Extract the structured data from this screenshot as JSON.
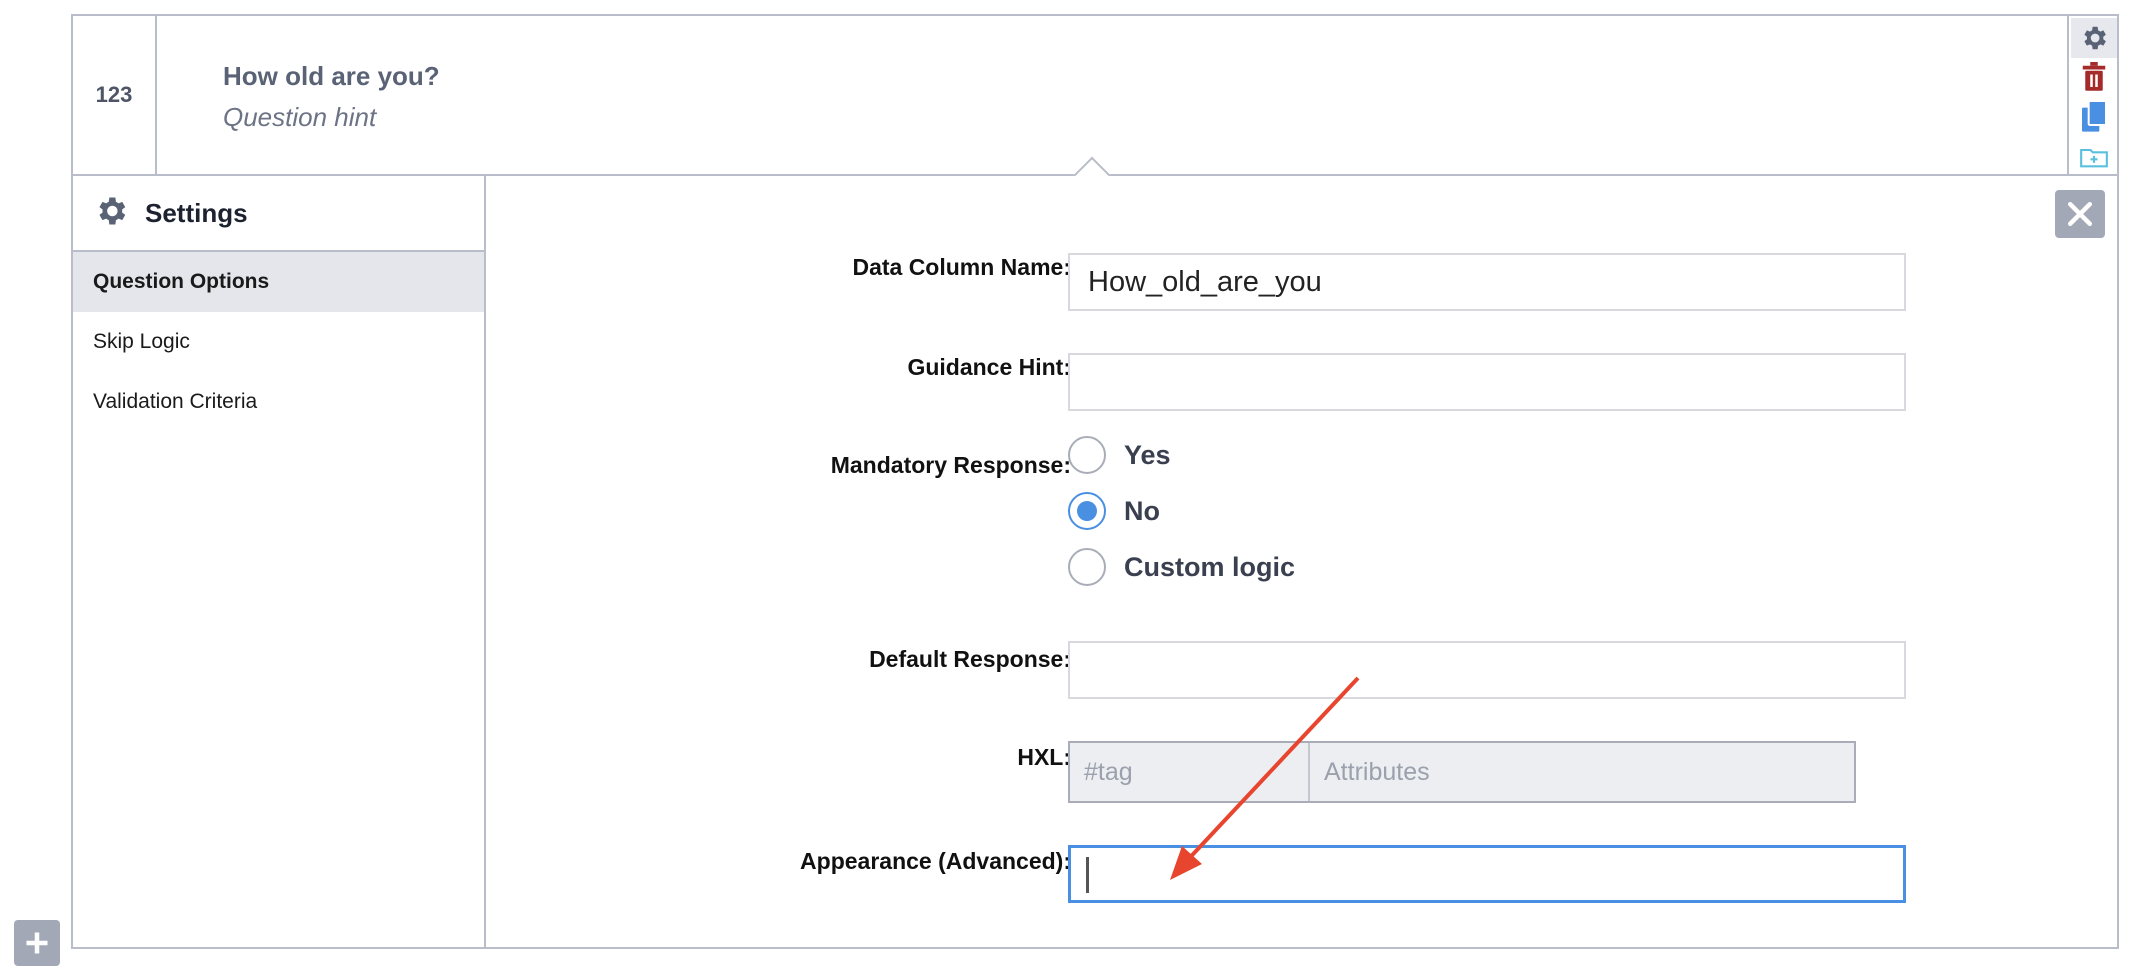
{
  "question": {
    "number": "123",
    "title": "How old are you?",
    "hint": "Question hint"
  },
  "toolbar": {
    "icons": [
      "gear-icon",
      "trash-icon",
      "copy-icon",
      "folder-add-icon"
    ],
    "colors": {
      "gear": "#5a6275",
      "trash": "#a52a2a",
      "copy": "#4a90e2",
      "folder": "#5bc0de"
    }
  },
  "settings": {
    "title": "Settings",
    "nav": [
      {
        "label": "Question Options",
        "active": true
      },
      {
        "label": "Skip Logic",
        "active": false
      },
      {
        "label": "Validation Criteria",
        "active": false
      }
    ]
  },
  "form": {
    "data_column_label": "Data Column Name:",
    "data_column_value": "How_old_are_you",
    "guidance_label": "Guidance Hint:",
    "guidance_value": "",
    "mandatory_label": "Mandatory Response:",
    "mandatory_options": [
      "Yes",
      "No",
      "Custom logic"
    ],
    "mandatory_selected": "No",
    "default_label": "Default Response:",
    "default_value": "",
    "hxl_label": "HXL:",
    "hxl_tag_placeholder": "#tag",
    "hxl_attr_placeholder": "Attributes",
    "appearance_label": "Appearance (Advanced):",
    "appearance_value": ""
  },
  "colors": {
    "accent": "#4a90e2",
    "border": "#b9bdc9",
    "annotation_arrow": "#e8452f"
  }
}
